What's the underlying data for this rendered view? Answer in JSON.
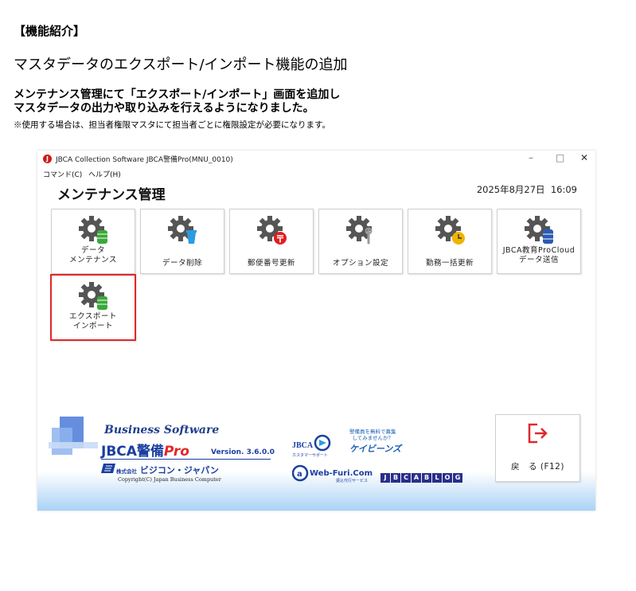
{
  "doc": {
    "heading": "【機能紹介】",
    "title": "マスタデータのエクスポート/インポート機能の追加",
    "lead_line1": "メンテナンス管理にて「エクスポート/インポート」画面を追加し",
    "lead_line2": "マスタデータの出力や取り込みを行えるようになりました。",
    "note": "※使用する場合は、担当者権限マスタにて担当者ごとに権限設定が必要になります。"
  },
  "window": {
    "title": "JBCA Collection Software JBCA警備Pro(MNU_0010)",
    "controls": {
      "minimize": "–",
      "maximize": "□",
      "close": "✕"
    }
  },
  "menu": [
    "コマンド(C)",
    "ヘルプ(H)"
  ],
  "page": {
    "title": "メンテナンス管理",
    "date": "2025年8月27日",
    "time": "16:09"
  },
  "tiles": [
    {
      "line1": "データ",
      "line2": "メンテナンス",
      "icon": "gear-database-icon"
    },
    {
      "line1": "",
      "line2": "データ削除",
      "icon": "gear-trash-icon"
    },
    {
      "line1": "",
      "line2": "郵便番号更新",
      "icon": "gear-postal-icon"
    },
    {
      "line1": "",
      "line2": "オプション設定",
      "icon": "gear-wrench-icon"
    },
    {
      "line1": "",
      "line2": "勤務一括更新",
      "icon": "gear-clock-icon"
    },
    {
      "line1": "JBCA教育ProCloud",
      "line2": "データ送信",
      "icon": "gear-cloud-db-icon"
    },
    {
      "line1": "エクスポート",
      "line2": "インポート",
      "icon": "gear-database-icon"
    }
  ],
  "footer": {
    "business": "Business Software",
    "product_a": "JBCA警備",
    "product_b": "Pro",
    "version": "Version. 3.6.0.0",
    "company_prefix": "株式会社",
    "company": "ビジコン・ジャパン",
    "copyright": "Copyright(C) Japan Business Computer",
    "support": "JBCA",
    "support_sub": "カスタマーサポート",
    "keibi_small1": "警備員を無料で募集",
    "keibi_small2": "してみませんか？",
    "keibi_logo": "ケイビーンズ",
    "webfuri": "Web-Furi.Com",
    "webfuri_sub": "振込代行サービス",
    "blog_letters": [
      "J",
      "B",
      "C",
      "A",
      "B",
      "L",
      "O",
      "G"
    ]
  },
  "back_button": {
    "label": "戻　る (F12)",
    "icon": "exit-icon"
  },
  "colors": {
    "highlight": "#e0282a",
    "brand_blue": "#1b3fa0",
    "back_icon": "#e0282a"
  }
}
